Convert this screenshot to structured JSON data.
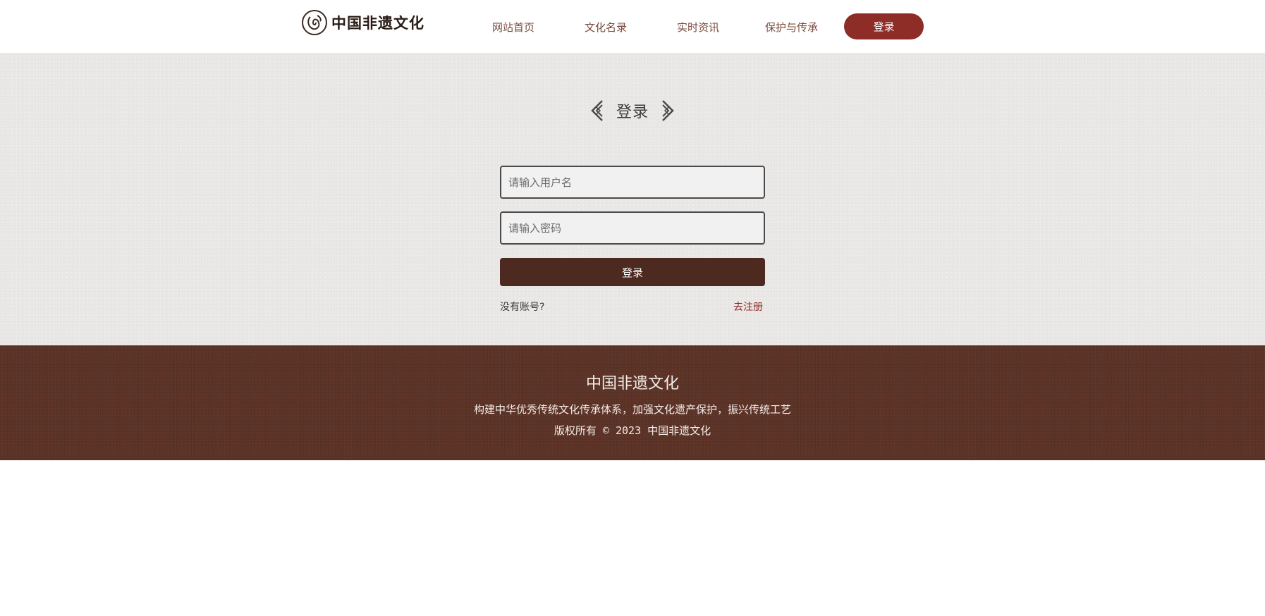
{
  "header": {
    "logo_text": "中国非遗文化",
    "nav": [
      {
        "label": "网站首页"
      },
      {
        "label": "文化名录"
      },
      {
        "label": "实时资讯"
      },
      {
        "label": "保护与传承"
      }
    ],
    "login_button": "登录"
  },
  "login_form": {
    "title": "登录",
    "username_placeholder": "请输入用户名",
    "password_placeholder": "请输入密码",
    "submit_label": "登录",
    "no_account_text": "没有账号?",
    "register_link": "去注册"
  },
  "footer": {
    "title": "中国非遗文化",
    "slogan": "构建中华优秀传统文化传承体系，加强文化遗产保护，振兴传统工艺",
    "copyright": "版权所有 © 2023 中国非遗文化"
  },
  "colors": {
    "accent": "#8e2c28",
    "button_dark": "#4d2a20",
    "footer_bg": "#5e3428",
    "main_bg": "#e9e8e6"
  },
  "icons": {
    "logo": "seal-logo-icon",
    "title_left": "ornament-left-icon",
    "title_right": "ornament-right-icon"
  }
}
